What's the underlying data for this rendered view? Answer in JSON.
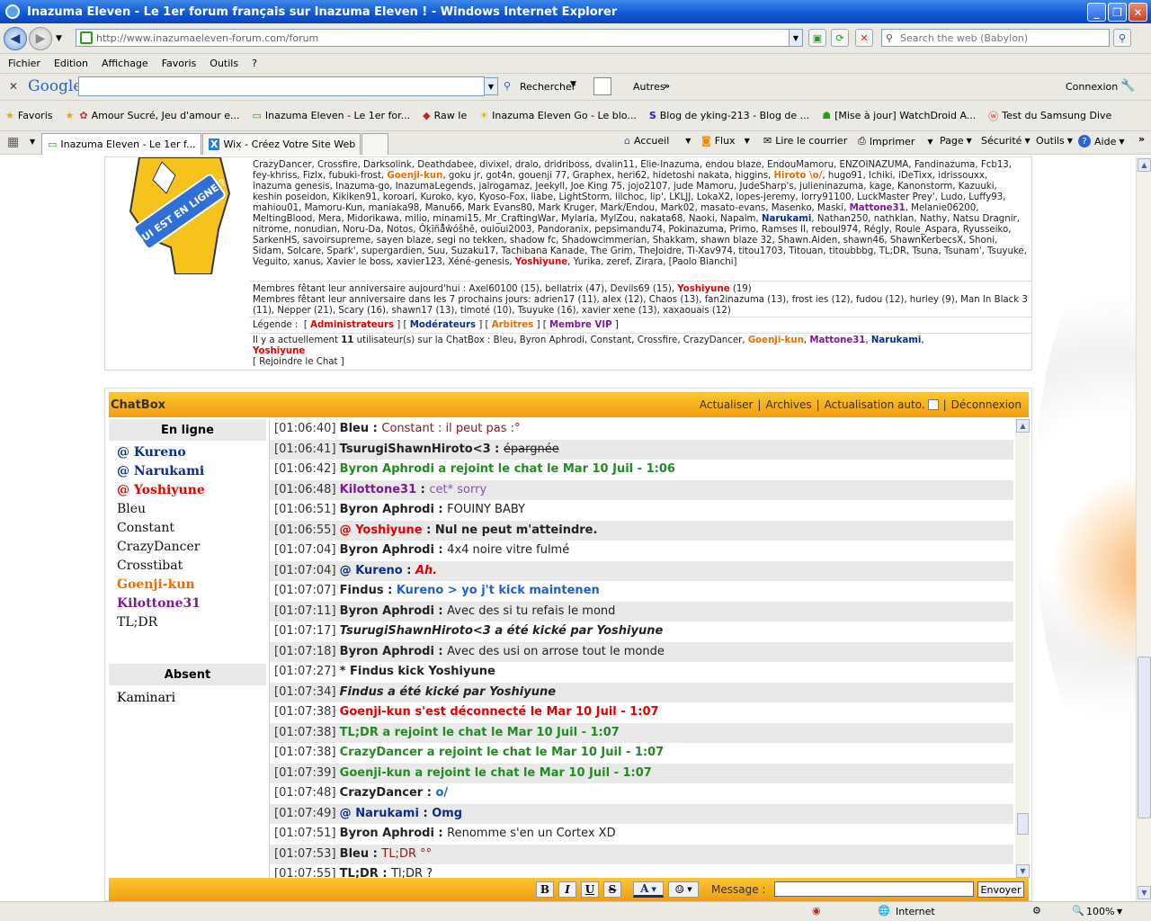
{
  "window": {
    "title": "Inazuma Eleven - Le 1er forum français sur Inazuma Eleven ! - Windows Internet Explorer"
  },
  "address": {
    "url": "http://www.inazumaeleven-forum.com/forum",
    "search_placeholder": "Search the web (Babylon)"
  },
  "menu": [
    "Fichier",
    "Edition",
    "Affichage",
    "Favoris",
    "Outils",
    "?"
  ],
  "google": {
    "logo": "Google",
    "search_label": "Rechercher",
    "others": "Autres",
    "connexion": "Connexion"
  },
  "favorites": {
    "label": "Favoris",
    "items": [
      "Amour Sucré, Jeu d'amour e...",
      "Inazuma Eleven - Le 1er for...",
      "Raw Ie",
      "Inazuma Eleven Go - Le blo...",
      "Blog de yking-213 - Blog de ...",
      "[Mise à jour] WatchDroid  A...",
      "Test du Samsung Dive"
    ]
  },
  "tabs": [
    "Inazuma Eleven - Le 1er f...",
    "Wix - Créez Votre Site Web ..."
  ],
  "commands": [
    "Accueil",
    "Flux",
    "Lire le courrier",
    "Imprimer",
    "Page",
    "Sécurité",
    "Outils",
    "Aide"
  ],
  "who_online": {
    "mascot_text": "QUI EST EN LIGNE ?",
    "members_text": "CrazyDancer, Crossfire, Darksolink, Deathdabee, divixel, dralo, dridriboss, dvalin11, Elie-Inazuma, endou blaze, EndouMamoru, ENZOINAZUMA, Fandinazuma, Fcb13, fey-khriss, Fizlx, fubuki-frost, ",
    "m_goenji": "Goenji-kun",
    "members_text2": ", goku jr, got4n, gouenji 77, Graphex, heri62, hidetoshi nakata, higgins, ",
    "m_hiroto": "Hiroto \\o/",
    "members_text3": ", hugo91, Ichiki, iDeTixx, idrissouxx, inazuma genesis, Inazuma-go, InazumaLegends, jalrogamaz, Jeekyll, Joe King 75, jojo2107, jude Mamoru, JudeSharp's, julieninazuma, kage, Kanonstorm, Kazuuki, keshin poseidon, Kikiken91, koroari, Kuroko, kyo, Kyoso-Fox, liabe, LightStorm, lilchoc, lip', LKLJJ, LokaX2, lopes-jeremy, lorry91100, LuckMaster Prey', Ludo, Luffy93, mahiou01, Mamoru-Kun, maniaka98, Manu66, Mark Evans80, Mark Kruger, Mark/Endou, Mark02, masato-evans, Masenko, Maski, ",
    "m_mattone": "Mattone31",
    "members_text4": ", Melanie06200, MeltingBlood, Mera, Midorikawa, milio, minami15, Mr_CraftingWar, Mylaria, MylZou, nakata68, Naoki, Napalm, ",
    "m_narukami": "Narukami",
    "members_text5": ", Nathan250, nathklan, Nathy, Natsu Dragnir, nitrome, nonudian, Noru-Da, Notos, Ǒķīñå̊ŵóšhě, ouioui2003, Pandoranix, pepsimandu74, Pokinazuma, Primo, Ramses II, reboul974, Régly, Roule_Aspara, Ryusseiko, SarkenHS, savoirsupreme, sayen blaze, segi no tekken, shadow fc, Shadowcimmerian, Shakkam, shawn blaze 32, Shawn.Aiden, shawn46, ShawnKerbecsX, Shoni, Sidam, Solcare, Spark', supergardien, Suu, Suzaku17, Tachibana Kanade, The Grim, TheJoidre, Ti-Xav974, titou1703, Titouan, titoubbbg, TL;DR, Tsuna, Tsunam', Tsuyuke, Veguito, xanus, Xavier le boss, xavier123, Xéné-genesis, ",
    "m_yoshiyune": "Yoshiyune",
    "members_text6": ", Yurika, zeref, Zirara, [Paolo Bianchi]",
    "bday_today_label": "Membres fêtant leur anniversaire aujourd'hui : ",
    "bday_today": "Axel60100 (15), bellatrix (47), Devils69 (15), ",
    "bday_today_yoshi": "Yoshiyune",
    "bday_today_end": " (19)",
    "bday_week": "Membres fêtant leur anniversaire dans les 7 prochains jours: adrien17 (11), alex (12), Chaos (13), fan2inazuma (13), frost ies (12), fudou (12), hurley (9), Man In Black 3 (11), Nepper (21), Scary (16), shawn17 (13), timoté (10), Tsuyuke (16), xavier xene (13), xaxaouais (12)",
    "legend_label": "Légende :",
    "legend_admin": "Administrateurs",
    "legend_mod": "Modérateurs",
    "legend_arb": "Arbitres",
    "legend_vip": "Membre VIP",
    "chat_prefix": "Il y a actuellement ",
    "chat_count": "11",
    "chat_mid": " utilisateur(s) sur la ChatBox :  Bleu, Byron Aphrodi, Constant, Crossfire, CrazyDancer, ",
    "chat_goenji": "Goenji-kun",
    "chat_mattone": "Mattone31",
    "chat_narukami": "Narukami",
    "chat_yoshi": "Yoshiyune",
    "join": "[ Rejoindre le Chat ]"
  },
  "chatbox": {
    "title": "ChatBox",
    "actions": [
      "Actualiser",
      "Archives",
      "Actualisation auto.",
      "Déconnexion"
    ],
    "online_header": "En ligne",
    "online": [
      {
        "name": "@ Kureno",
        "color": "#0d2c8c",
        "bold": true
      },
      {
        "name": "@ Narukami",
        "color": "#0d2c8c",
        "bold": true
      },
      {
        "name": "@ Yoshiyune",
        "color": "#e30000",
        "bold": true
      },
      {
        "name": "Bleu",
        "color": "#111",
        "bold": false
      },
      {
        "name": "Constant",
        "color": "#111",
        "bold": false
      },
      {
        "name": "CrazyDancer",
        "color": "#111",
        "bold": false
      },
      {
        "name": "Crosstibat",
        "color": "#111",
        "bold": false
      },
      {
        "name": "Goenji-kun",
        "color": "#ef6c00",
        "bold": true
      },
      {
        "name": "Kilottone31",
        "color": "#7b1a97",
        "bold": true
      },
      {
        "name": "TL;DR",
        "color": "#111",
        "bold": false
      }
    ],
    "absent_header": "Absent",
    "absent": [
      "Kaminari"
    ],
    "messages": [
      {
        "ts": "[01:06:40]",
        "user": "Bleu",
        "ucolor": "#222",
        "sep": " : ",
        "text": "Constant : il peut pas :°",
        "tcolor": "#8b1a1a",
        "style": "normal"
      },
      {
        "ts": "[01:06:41]",
        "user": "TsurugiShawnHiroto<3",
        "ucolor": "#222",
        "sep": " : ",
        "text": "épargnée",
        "tcolor": "#222",
        "style": "strike"
      },
      {
        "ts": "[01:06:42]",
        "user": "",
        "ucolor": "#228b22",
        "sep": "",
        "text": "Byron Aphrodi a rejoint le chat le Mar 10 Juil - 1:06",
        "tcolor": "#228b22",
        "style": "sys"
      },
      {
        "ts": "[01:06:48]",
        "user": "Kilottone31",
        "ucolor": "#7b1a97",
        "sep": " : ",
        "text": "cet* sorry",
        "tcolor": "#8a4fb0",
        "style": "normal"
      },
      {
        "ts": "[01:06:51]",
        "user": "Byron Aphrodi",
        "ucolor": "#222",
        "sep": " : ",
        "text": "FOUINY BABY",
        "tcolor": "#222",
        "style": "normal"
      },
      {
        "ts": "[01:06:55]",
        "user": "@ Yoshiyune",
        "ucolor": "#e30000",
        "sep": " : ",
        "text": "Nul ne peut m'atteindre.",
        "tcolor": "#222",
        "style": "bold"
      },
      {
        "ts": "[01:07:04]",
        "user": "Byron Aphrodi",
        "ucolor": "#222",
        "sep": " : ",
        "text": "4x4 noire vitre fulmé",
        "tcolor": "#222",
        "style": "normal"
      },
      {
        "ts": "[01:07:04]",
        "user": "@ Kureno",
        "ucolor": "#0d2c8c",
        "sep": " : ",
        "text": "Ah.",
        "tcolor": "#e30000",
        "style": "italicbold"
      },
      {
        "ts": "[01:07:07]",
        "user": "Findus",
        "ucolor": "#222",
        "sep": " : ",
        "text": "Kureno > yo j't kick maintenen",
        "tcolor": "#1f5fd0",
        "style": "bold"
      },
      {
        "ts": "[01:07:11]",
        "user": "Byron Aphrodi",
        "ucolor": "#222",
        "sep": " : ",
        "text": "Avec des si tu refais le mond",
        "tcolor": "#222",
        "style": "normal"
      },
      {
        "ts": "[01:07:17]",
        "user": "",
        "ucolor": "#222",
        "sep": "",
        "text": "TsurugiShawnHiroto<3 a été kické par Yoshiyune",
        "tcolor": "#222",
        "style": "kick"
      },
      {
        "ts": "[01:07:18]",
        "user": "Byron Aphrodi",
        "ucolor": "#222",
        "sep": " : ",
        "text": "Avec des usi on arrose tout le monde",
        "tcolor": "#222",
        "style": "normal"
      },
      {
        "ts": "[01:07:27]",
        "user": "",
        "ucolor": "#222",
        "sep": "",
        "text": "* Findus kick Yoshiyune",
        "tcolor": "#222",
        "style": "bold"
      },
      {
        "ts": "[01:07:34]",
        "user": "",
        "ucolor": "#222",
        "sep": "",
        "text": "Findus a été kické par Yoshiyune",
        "tcolor": "#222",
        "style": "kick"
      },
      {
        "ts": "[01:07:38]",
        "user": "",
        "ucolor": "#e30000",
        "sep": "",
        "text": "Goenji-kun s'est déconnecté le Mar 10 Juil - 1:07",
        "tcolor": "#e30000",
        "style": "bold"
      },
      {
        "ts": "[01:07:38]",
        "user": "",
        "ucolor": "#228b22",
        "sep": "",
        "text": "TL;DR a rejoint le chat le Mar 10 Juil - 1:07",
        "tcolor": "#228b22",
        "style": "sys"
      },
      {
        "ts": "[01:07:38]",
        "user": "",
        "ucolor": "#228b22",
        "sep": "",
        "text": "CrazyDancer a rejoint le chat le Mar 10 Juil - 1:07",
        "tcolor": "#228b22",
        "style": "sys"
      },
      {
        "ts": "[01:07:39]",
        "user": "",
        "ucolor": "#228b22",
        "sep": "",
        "text": "Goenji-kun a rejoint le chat le Mar 10 Juil - 1:07",
        "tcolor": "#228b22",
        "style": "sys"
      },
      {
        "ts": "[01:07:48]",
        "user": "CrazyDancer",
        "ucolor": "#222",
        "sep": " : ",
        "text": "o/",
        "tcolor": "#1f5fd0",
        "style": "bold"
      },
      {
        "ts": "[01:07:49]",
        "user": "@ Narukami",
        "ucolor": "#0d2c8c",
        "sep": " : ",
        "text": "Omg",
        "tcolor": "#0d2c8c",
        "style": "bold"
      },
      {
        "ts": "[01:07:51]",
        "user": "Byron Aphrodi",
        "ucolor": "#222",
        "sep": " : ",
        "text": "Renomme s'en un Cortex XD",
        "tcolor": "#222",
        "style": "normal"
      },
      {
        "ts": "[01:07:53]",
        "user": "Bleu",
        "ucolor": "#222",
        "sep": " : ",
        "text": "TL;DR °°",
        "tcolor": "#8b1a1a",
        "style": "normal"
      },
      {
        "ts": "[01:07:55]",
        "user": "TL;DR",
        "ucolor": "#222",
        "sep": " : ",
        "text": "Tl;DR ?",
        "tcolor": "#222",
        "style": "normal"
      }
    ],
    "format_buttons": [
      "B",
      "I",
      "U",
      "S",
      "A",
      "☺"
    ],
    "message_label": "Message :",
    "message_value": "",
    "send": "Envoyer"
  },
  "status": {
    "zone": "Internet",
    "zoom": "100%"
  }
}
